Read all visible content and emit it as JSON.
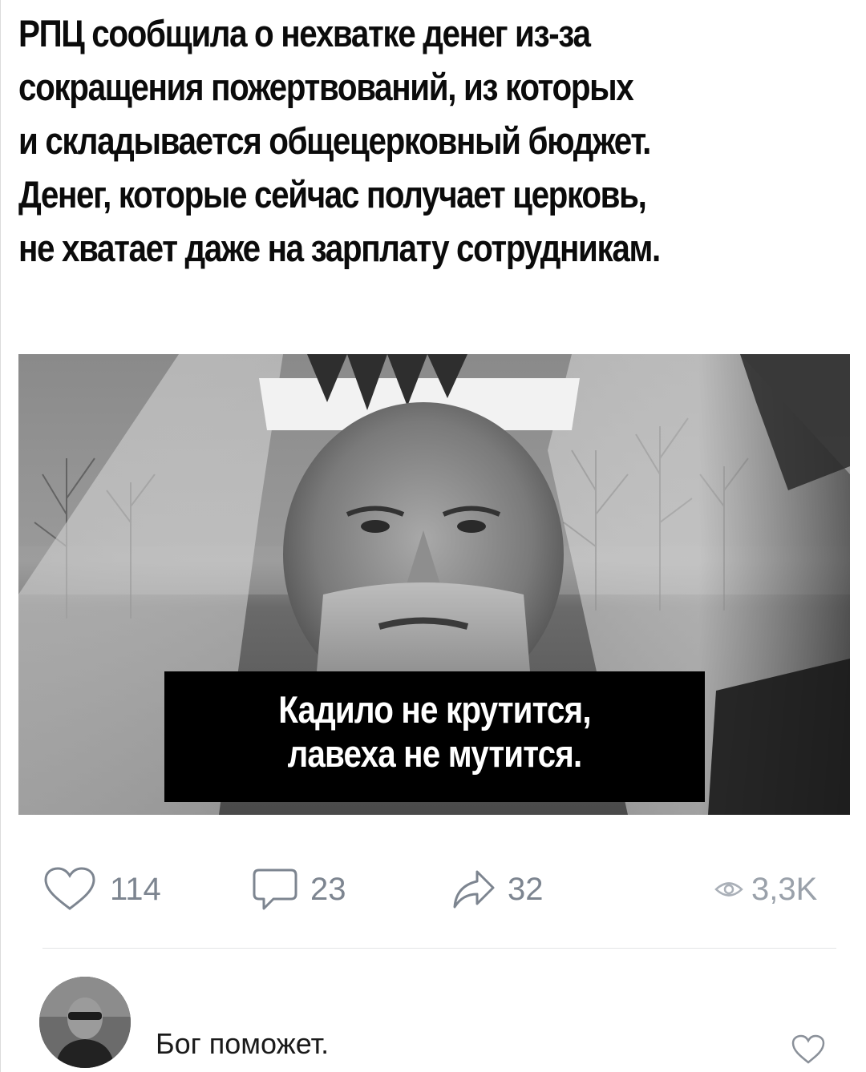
{
  "post": {
    "headline_lines": [
      "РПЦ сообщила о нехватке денег из-за",
      "сокращения пожертвований, из которых",
      "и складывается общецерковный бюджет.",
      "Денег, которые сейчас получает церковь,",
      "не хватает даже на зарплату сотрудникам."
    ],
    "image": {
      "caption_lines": [
        "Кадило не крутится,",
        "лавеха не мутится."
      ]
    },
    "actions": {
      "likes": "114",
      "comments": "23",
      "shares": "32",
      "views": "3,3K"
    },
    "icons": {
      "like": "heart-outline-icon",
      "comment": "speech-bubble-icon",
      "share": "share-arrow-icon",
      "views": "eye-icon"
    },
    "colors": {
      "action_gray": "#7d8590",
      "caption_bg": "#000000",
      "caption_text": "#ffffff"
    }
  },
  "comments": [
    {
      "text": "Бог поможет."
    }
  ]
}
